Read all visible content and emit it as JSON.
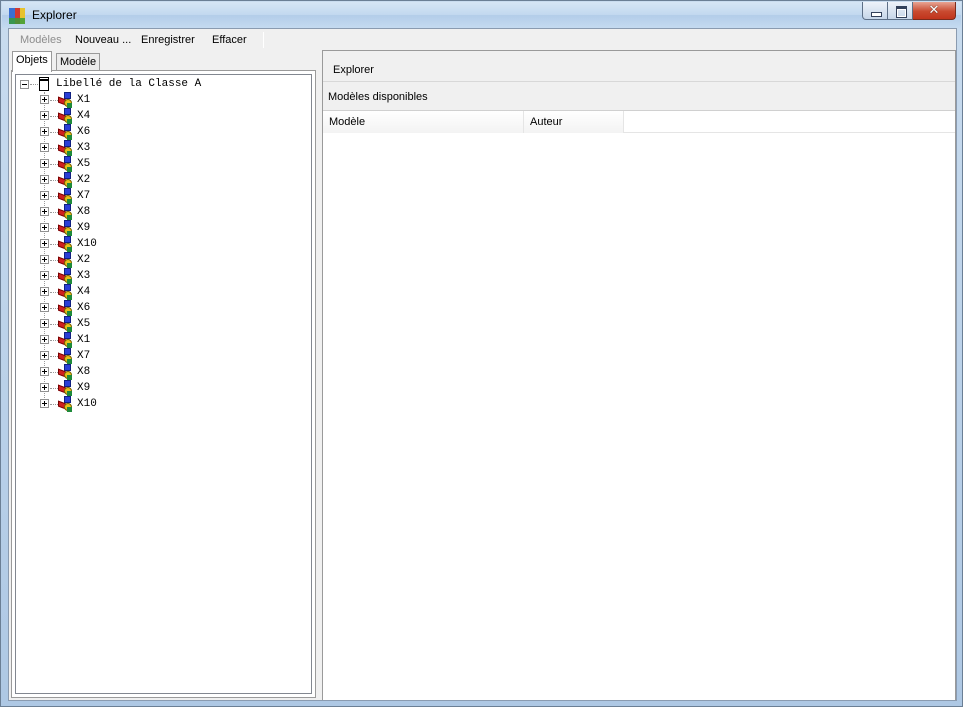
{
  "window": {
    "title": "Explorer",
    "close_glyph": "✕"
  },
  "toolbar": {
    "modeles_label": "Modèles",
    "nouveau_label": "Nouveau ...",
    "enregistrer_label": "Enregistrer",
    "effacer_label": "Effacer"
  },
  "tabs": [
    {
      "label": "Objets"
    },
    {
      "label": "Modèle"
    }
  ],
  "tree": {
    "root_label": "Libellé de la Classe A",
    "items": [
      "X1",
      "X4",
      "X6",
      "X3",
      "X5",
      "X2",
      "X7",
      "X8",
      "X9",
      "X10",
      "X2",
      "X3",
      "X4",
      "X6",
      "X5",
      "X1",
      "X7",
      "X8",
      "X9",
      "X10"
    ]
  },
  "right_panel": {
    "title": "Explorer",
    "subtitle": "Modèles disponibles",
    "columns": [
      "Modèle",
      "Auteur"
    ]
  },
  "colors": {
    "titlebar": "#c2d8ef",
    "close_button": "#c94a30",
    "node_blue": "#2b3fd6",
    "node_red": "#d02020",
    "node_yellow": "#e6c21a",
    "node_green": "#1e8a3a"
  },
  "icons": {
    "app": "app-colorblocks-icon",
    "node": "object-node-icon",
    "root": "class-document-icon"
  }
}
